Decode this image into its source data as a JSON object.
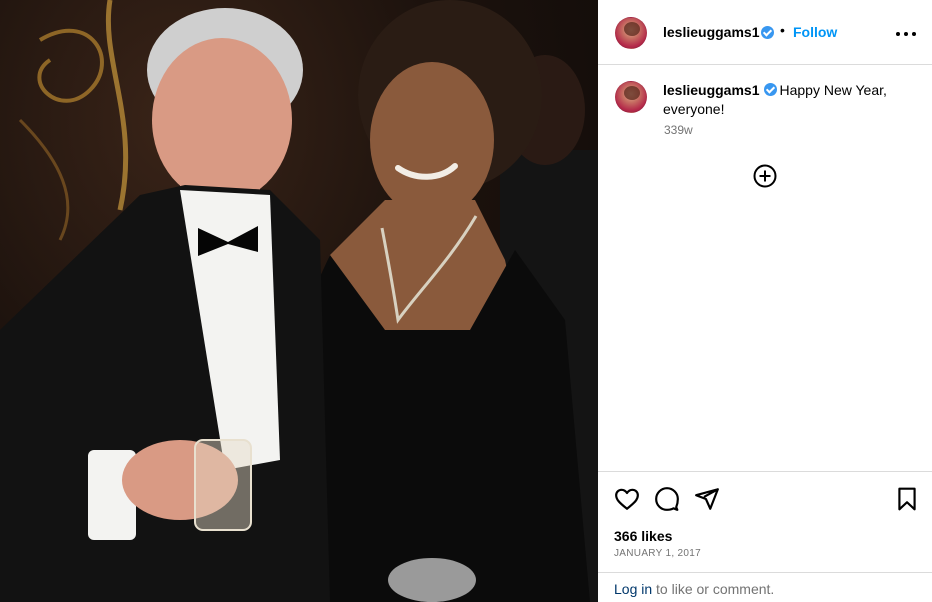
{
  "post": {
    "username": "leslieuggams1",
    "verified": true,
    "follow_label": "Follow",
    "separator": "•",
    "more_icon": "more-horizontal-icon"
  },
  "caption": {
    "username": "leslieuggams1",
    "text": "Happy New Year, everyone!",
    "age": "339w"
  },
  "add_comment_icon": "add-circle-icon",
  "actions": {
    "icons": [
      "heart-icon",
      "comment-icon",
      "share-icon",
      "bookmark-icon"
    ],
    "likes": "366 likes",
    "date": "JANUARY 1, 2017"
  },
  "footer": {
    "login_link": "Log in",
    "login_rest": " to like or comment."
  },
  "colors": {
    "accent": "#0095f6",
    "verified": "#3897f0",
    "muted": "#737373",
    "border": "#dbdbdb",
    "link": "#00376b"
  }
}
